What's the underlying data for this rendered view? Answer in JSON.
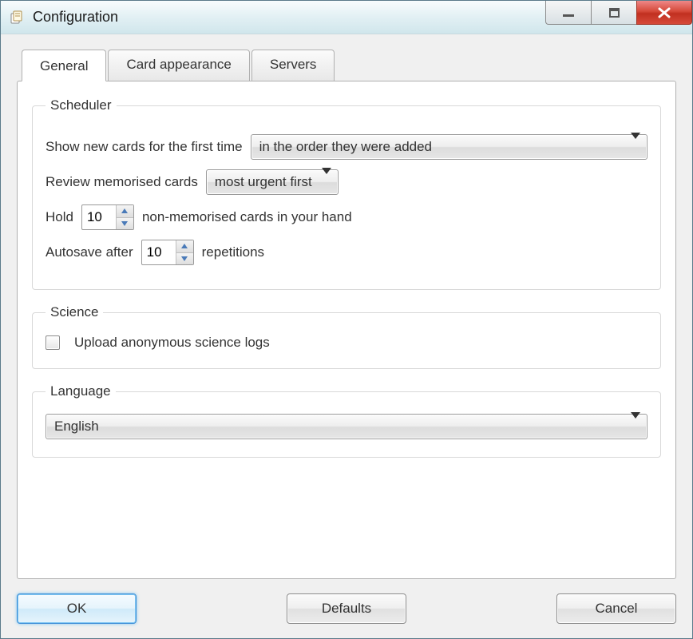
{
  "window": {
    "title": "Configuration"
  },
  "tabs": {
    "general": "General",
    "card_appearance": "Card appearance",
    "servers": "Servers"
  },
  "scheduler": {
    "legend": "Scheduler",
    "show_new_label": "Show new cards for the first time",
    "show_new_value": "in the order they were added",
    "review_label": "Review memorised cards",
    "review_value": "most urgent first",
    "hold_prefix": "Hold",
    "hold_value": "10",
    "hold_suffix": "non-memorised cards in your hand",
    "autosave_prefix": "Autosave after",
    "autosave_value": "10",
    "autosave_suffix": "repetitions"
  },
  "science": {
    "legend": "Science",
    "upload_label": "Upload anonymous science logs",
    "upload_checked": false
  },
  "language": {
    "legend": "Language",
    "value": "English"
  },
  "buttons": {
    "ok": "OK",
    "defaults": "Defaults",
    "cancel": "Cancel"
  }
}
